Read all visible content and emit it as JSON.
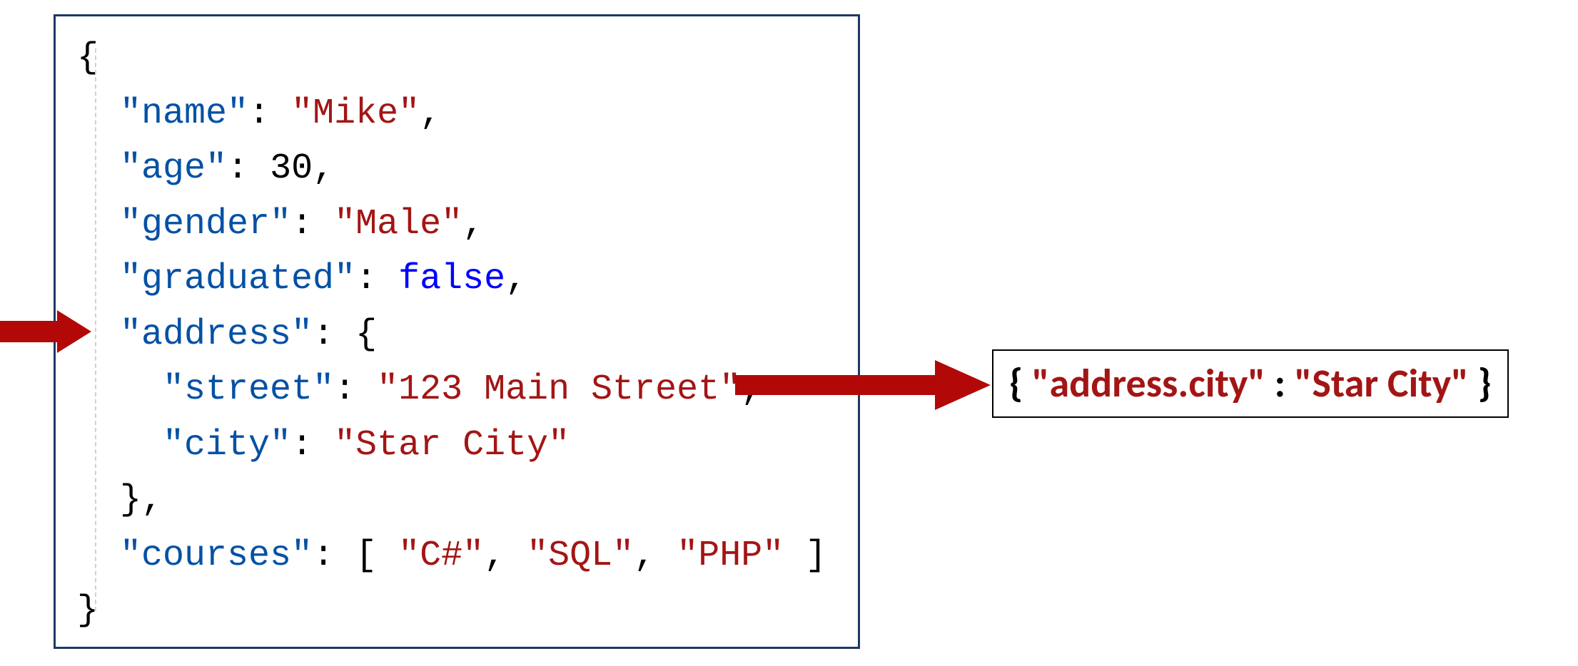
{
  "code": {
    "l0": "{",
    "l1_key": "\"name\"",
    "l1_val": "\"Mike\"",
    "l2_key": "\"age\"",
    "l2_val": "30",
    "l3_key": "\"gender\"",
    "l3_val": "\"Male\"",
    "l4_key": "\"graduated\"",
    "l4_val": "false",
    "l5_key": "\"address\"",
    "l6_key": "\"street\"",
    "l6_val": "\"123 Main Street\"",
    "l7_key": "\"city\"",
    "l7_val": "\"Star City\"",
    "l9_key": "\"courses\"",
    "l9_a": "\"C#\"",
    "l9_b": "\"SQL\"",
    "l9_c": "\"PHP\"",
    "l10": "}"
  },
  "annotation": {
    "open": "{ ",
    "key": "\"address.city\"",
    "sep": " :  ",
    "val": "\"Star City\"",
    "close": " }"
  },
  "json_example": {
    "name": "Mike",
    "age": 30,
    "gender": "Male",
    "graduated": false,
    "address": {
      "street": "123 Main Street",
      "city": "Star City"
    },
    "courses": [
      "C#",
      "SQL",
      "PHP"
    ]
  },
  "flattened_example": {
    "address.city": "Star City"
  }
}
